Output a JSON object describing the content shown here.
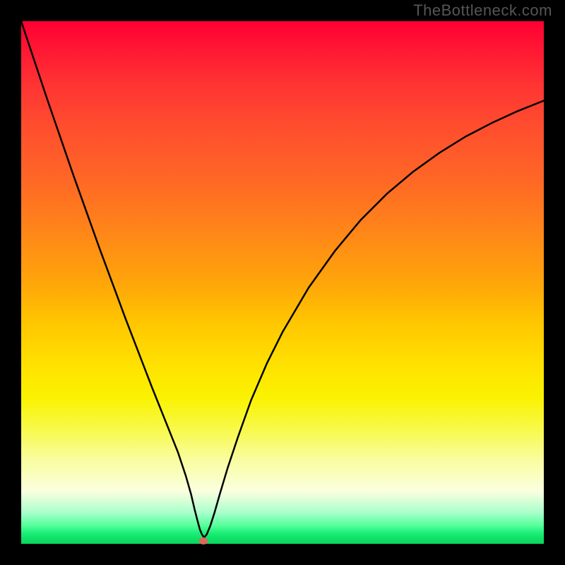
{
  "watermark": "TheBottleneck.com",
  "chart_data": {
    "type": "line",
    "title": "",
    "xlabel": "",
    "ylabel": "",
    "xlim": [
      0,
      1
    ],
    "ylim": [
      0,
      1
    ],
    "grid": false,
    "legend": false,
    "series": [
      {
        "name": "curve",
        "x": [
          0.0,
          0.05,
          0.1,
          0.15,
          0.2,
          0.25,
          0.28,
          0.3,
          0.315,
          0.325,
          0.332,
          0.338,
          0.342,
          0.346,
          0.35,
          0.355,
          0.362,
          0.37,
          0.38,
          0.395,
          0.415,
          0.44,
          0.47,
          0.5,
          0.55,
          0.6,
          0.65,
          0.7,
          0.75,
          0.8,
          0.85,
          0.9,
          0.95,
          1.0
        ],
        "y": [
          1.0,
          0.85,
          0.705,
          0.565,
          0.43,
          0.3,
          0.225,
          0.175,
          0.13,
          0.095,
          0.065,
          0.042,
          0.027,
          0.018,
          0.012,
          0.018,
          0.035,
          0.06,
          0.095,
          0.145,
          0.205,
          0.275,
          0.345,
          0.405,
          0.49,
          0.56,
          0.62,
          0.67,
          0.712,
          0.748,
          0.779,
          0.805,
          0.828,
          0.848
        ]
      }
    ],
    "annotations": [
      {
        "name": "min-marker",
        "x": 0.349,
        "y": 0.005,
        "color": "#db6a59"
      }
    ],
    "background_gradient": {
      "orientation": "vertical",
      "stops": [
        {
          "pos": 0.0,
          "color": "#ff0033"
        },
        {
          "pos": 0.5,
          "color": "#ffa50a"
        },
        {
          "pos": 0.78,
          "color": "#f9fda0"
        },
        {
          "pos": 0.97,
          "color": "#55ff99"
        },
        {
          "pos": 1.0,
          "color": "#0ad65f"
        }
      ]
    }
  }
}
